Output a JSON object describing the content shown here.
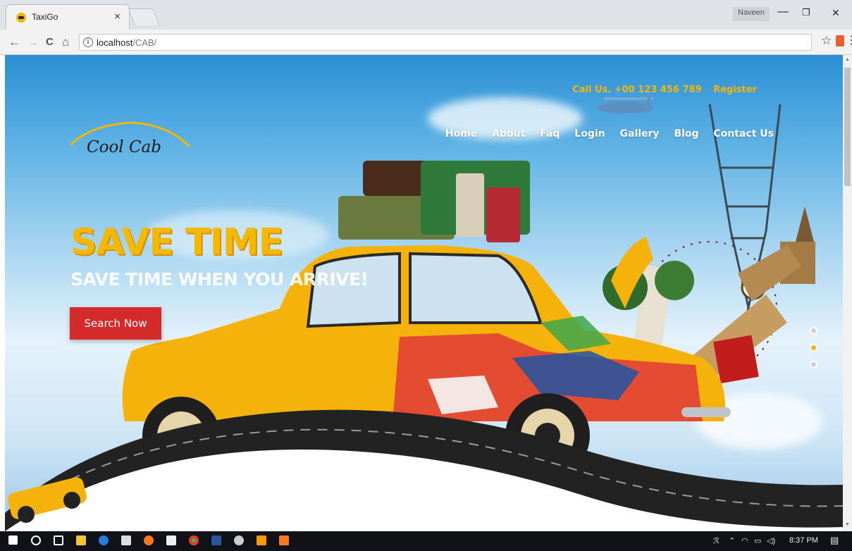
{
  "browser": {
    "tab_title": "TaxiGo",
    "tab_close": "×",
    "profile_name": "Naveen",
    "minimize": "—",
    "maximize": "❐",
    "close": "✕",
    "back": "←",
    "forward": "→",
    "reload": "C",
    "home": "⌂",
    "url_host": "localhost",
    "url_path": "/CAB/",
    "star": "☆",
    "menu": "⋮"
  },
  "site": {
    "topbar": {
      "call_label": "Call Us. +00 123 456 789",
      "register_label": "Register"
    },
    "logo_text": "Cool Cab",
    "nav": [
      "Home",
      "About",
      "Faq",
      "Login",
      "Gallery",
      "Blog",
      "Contact Us"
    ],
    "hero": {
      "title": "SAVE TIME",
      "subtitle": "SAVE TIME WHEN YOU ARRIVE!",
      "button_label": "Search Now"
    },
    "slider": {
      "count": 3,
      "active_index": 1
    },
    "colors": {
      "accent": "#f2b705",
      "button": "#d42a2a"
    }
  },
  "taskbar": {
    "time": "8:37 PM",
    "tray_icons": [
      "people-icon",
      "chevron-up-icon",
      "wifi-icon",
      "keyboard-icon",
      "volume-icon"
    ],
    "icons": [
      "windows-start-icon",
      "cortana-icon",
      "task-view-icon",
      "file-explorer-icon",
      "edge-icon",
      "store-icon",
      "firefox-icon",
      "mail-icon",
      "chrome-icon",
      "word-icon",
      "settings-icon",
      "sublime-icon",
      "xampp-icon"
    ]
  }
}
